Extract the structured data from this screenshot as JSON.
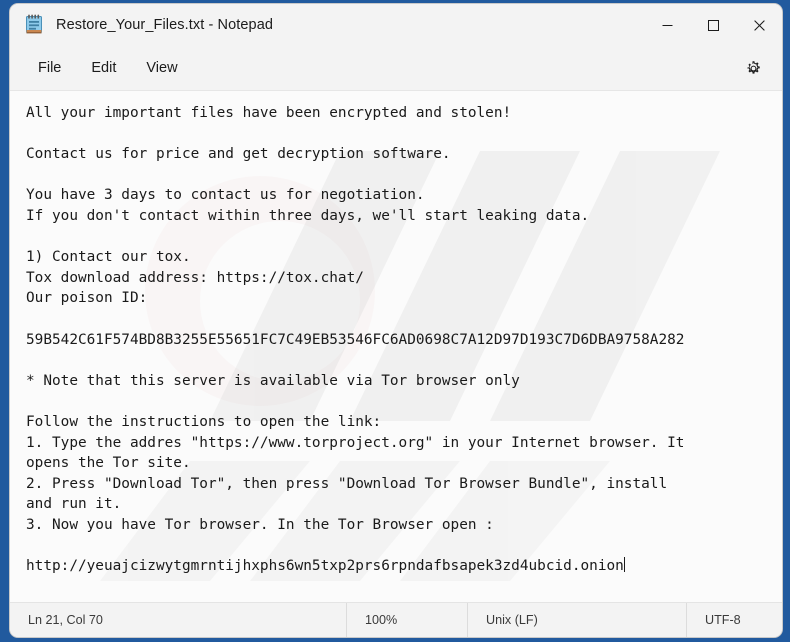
{
  "window": {
    "title": "Restore_Your_Files.txt - Notepad",
    "icon": "notepad-icon",
    "controls": {
      "minimize": "minimize-icon",
      "maximize": "maximize-icon",
      "close": "close-icon"
    }
  },
  "menu": {
    "items": [
      {
        "label": "File"
      },
      {
        "label": "Edit"
      },
      {
        "label": "View"
      }
    ],
    "settings_icon": "gear-icon"
  },
  "editor": {
    "lines": [
      "All your important files have been encrypted and stolen!",
      "",
      "Contact us for price and get decryption software.",
      "",
      "You have 3 days to contact us for negotiation.",
      "If you don't contact within three days, we'll start leaking data.",
      "",
      "1) Contact our tox.",
      "Tox download address: https://tox.chat/",
      "Our poison ID:",
      "",
      "59B542C61F574BD8B3255E55651FC7C49EB53546FC6AD0698C7A12D97D193C7D6DBA9758A282",
      "",
      "* Note that this server is available via Tor browser only",
      "",
      "Follow the instructions to open the link:",
      "1. Type the addres \"https://www.torproject.org\" in your Internet browser. It",
      "opens the Tor site.",
      "2. Press \"Download Tor\", then press \"Download Tor Browser Bundle\", install",
      "and run it.",
      "3. Now you have Tor browser. In the Tor Browser open :",
      "",
      "http://yeuajcizwytgmrntijhxphs6wn5txp2prs6rpndafbsapek3zd4ubcid.onion"
    ]
  },
  "status_bar": {
    "position": "Ln 21, Col 70",
    "zoom": "100%",
    "line_ending": "Unix (LF)",
    "encoding": "UTF-8"
  },
  "colors": {
    "desktop": "#215a9e",
    "chrome": "#f3f3f3",
    "editor_background": "#fbfbfb",
    "text": "#1a1a1a",
    "close_hover": "#e81123"
  }
}
